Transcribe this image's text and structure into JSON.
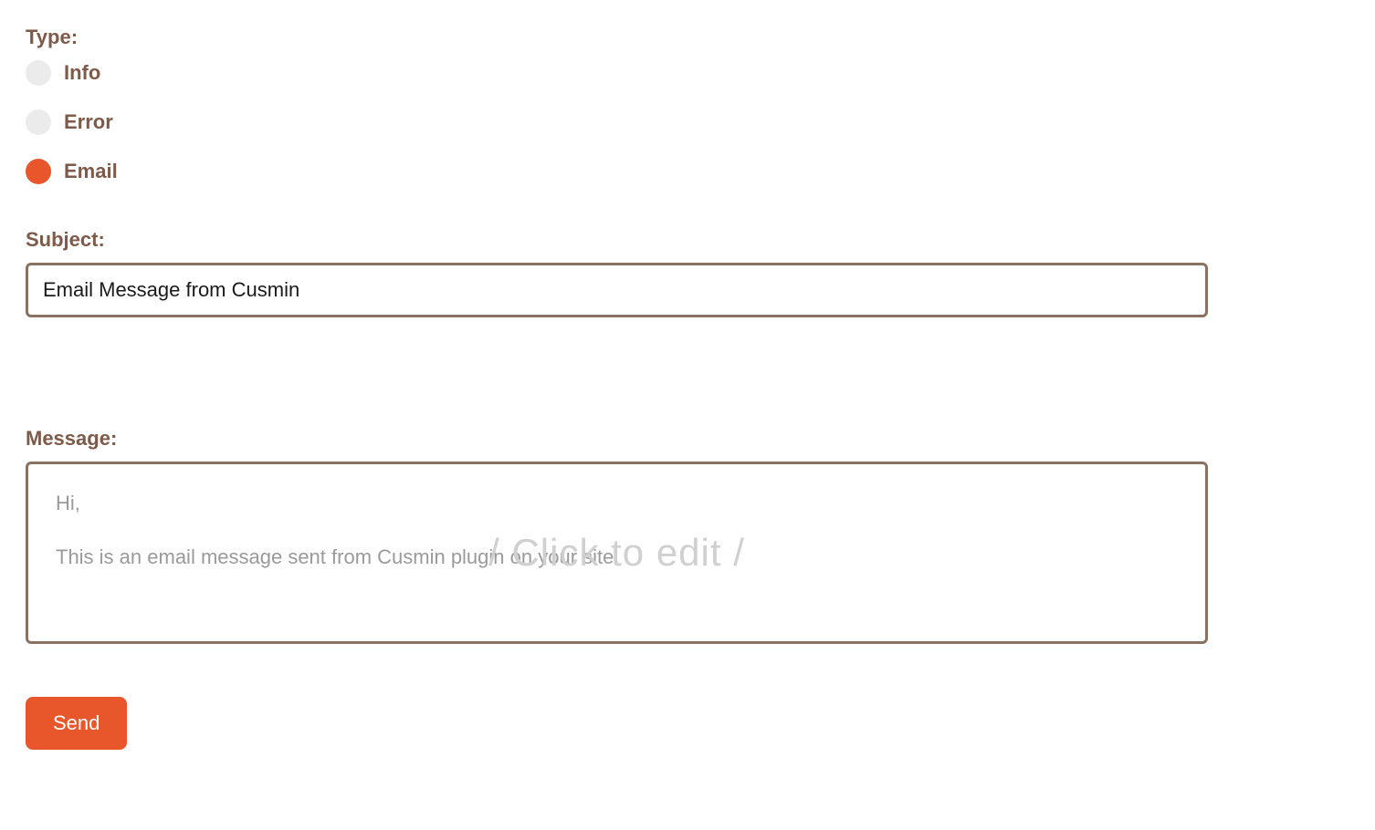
{
  "type": {
    "label": "Type:",
    "options": [
      {
        "label": "Info",
        "selected": false
      },
      {
        "label": "Error",
        "selected": false
      },
      {
        "label": "Email",
        "selected": true
      }
    ]
  },
  "subject": {
    "label": "Subject:",
    "value": "Email Message from Cusmin"
  },
  "message": {
    "label": "Message:",
    "lines": [
      "Hi,",
      "This is an email message sent from Cusmin plugin on your site."
    ],
    "overlay": "/ Click to edit /"
  },
  "send_button": {
    "label": "Send"
  },
  "colors": {
    "accent": "#e8562b",
    "label_text": "#7d5a4a",
    "border": "#8a7262"
  }
}
